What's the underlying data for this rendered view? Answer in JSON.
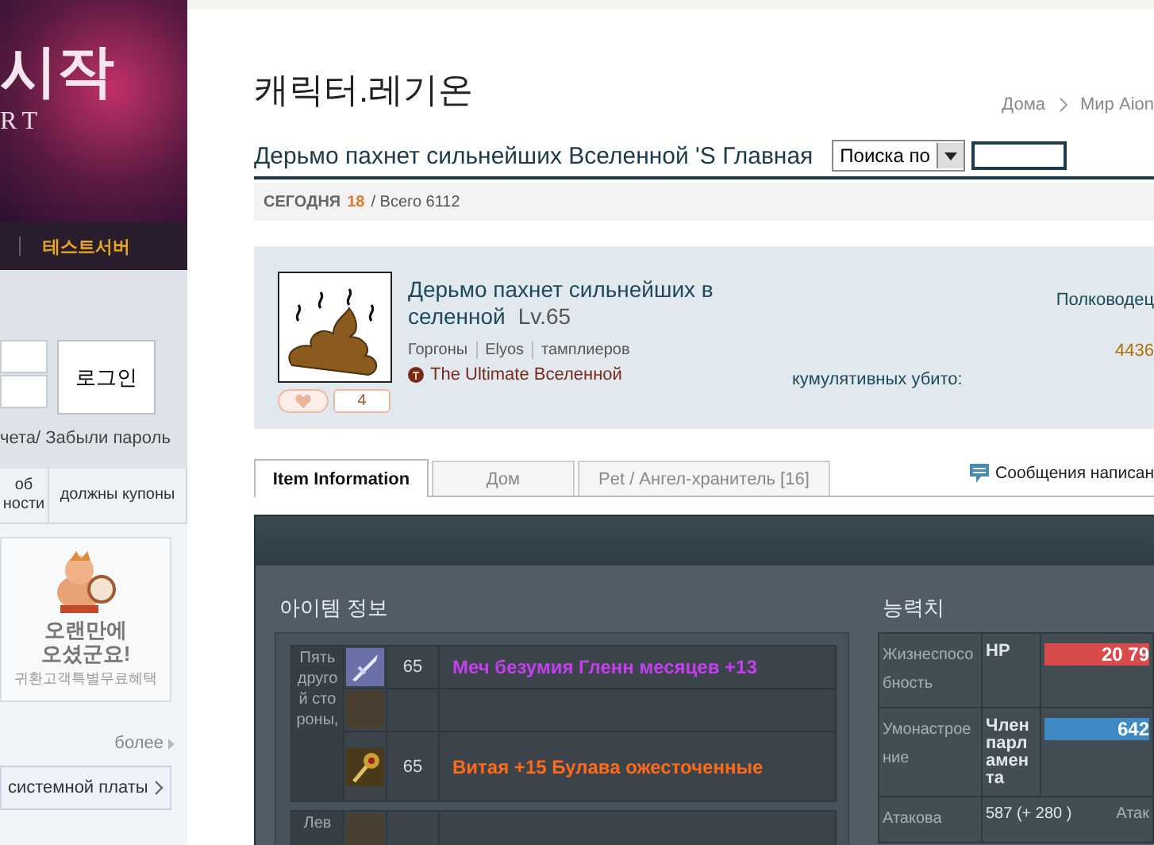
{
  "sidebar": {
    "banner": {
      "title": "시작",
      "subtitle": "RT"
    },
    "nav": [
      {
        "label": "테스트서버"
      }
    ],
    "login": {
      "button": "로그인",
      "links": "чета/ Забыли пароль"
    },
    "tabs": [
      {
        "label": "об ности"
      },
      {
        "label": "должны купоны"
      }
    ],
    "promo": {
      "title": "오랜만에 오셨군요!",
      "subtitle": "귀환고객특별무료혜택"
    },
    "more": "более",
    "menu": [
      {
        "label": "системной платы"
      }
    ]
  },
  "page": {
    "title": "캐릭터.레기온",
    "breadcrumb": [
      "Дома",
      "Мир Aion"
    ],
    "heading": "Дерьмо пахнет сильнейших Вселенной 'S Главная",
    "search": {
      "select": "Поиска по"
    },
    "counter": {
      "today_label": "СЕГОДНЯ",
      "today": "18",
      "total": "/ Всего 6112"
    }
  },
  "profile": {
    "name": "Дерьмо пахнет сильнейших в селенной",
    "level": "Lv.65",
    "tags": [
      "Горгоны",
      "Elyos",
      "тамплиеров"
    ],
    "legion": "The Ultimate Вселенной",
    "likes": "4",
    "rank": "Полководец",
    "points": "4436",
    "kills": "кумулятивных убито:"
  },
  "tabs": [
    {
      "label": "Item Information",
      "selected": true
    },
    {
      "label": "Дом",
      "selected": false
    },
    {
      "label": "Pet / Ангел-хранитель [16]",
      "selected": false
    }
  ],
  "messages": "Сообщения написан",
  "items": {
    "title": "아이템 정보",
    "groups": [
      {
        "slot": "Пять другой стороны,",
        "items": [
          {
            "kind": "sword",
            "level": "65",
            "name": "Меч безумия Гленн месяцев +13",
            "color": "#c53ff0"
          },
          {
            "kind": "empty"
          },
          {
            "kind": "mace",
            "level": "65",
            "name": "Витая +15 Булава ожесточенные",
            "color": "#ff6a1a"
          }
        ]
      },
      {
        "slot": "Лев",
        "items": [
          {
            "kind": "empty"
          }
        ]
      }
    ]
  },
  "stats": {
    "title": "능력치",
    "rows": [
      {
        "kind": "bar",
        "label": "Жизнеспособность",
        "bar_label": "HP",
        "value": "20 79",
        "color": "#d94a4a",
        "level": 1
      },
      {
        "kind": "bar",
        "label": "Умонастроение",
        "bar_label": "Член парламента",
        "value": "642",
        "color": "#3d8ac4",
        "level": 1
      },
      {
        "kind": "pair",
        "label": "Атакова",
        "value": "587 (+ 280 )",
        "label2": "Атак"
      }
    ]
  }
}
